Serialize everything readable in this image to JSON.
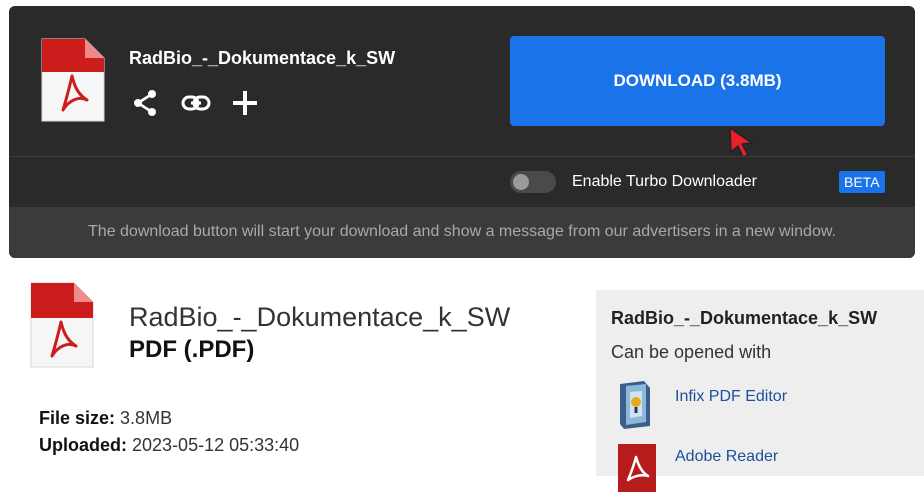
{
  "header": {
    "filename": "RadBio_-_Dokumentace_k_SW",
    "download_button_label": "DOWNLOAD (3.8MB)",
    "actions": [
      {
        "icon": "share-icon"
      },
      {
        "icon": "link-icon"
      },
      {
        "icon": "plus-icon"
      }
    ],
    "turbo": {
      "label": "Enable Turbo Downloader",
      "enabled": false,
      "badge": "BETA"
    },
    "notice": "The download button will start your download and show a message from our advertisers in a new window."
  },
  "file_info": {
    "name": "RadBio_-_Dokumentace_k_SW",
    "type": "PDF (.PDF)",
    "size_label": "File size:",
    "size_value": "3.8MB",
    "uploaded_label": "Uploaded:",
    "uploaded_value": "2023-05-12 05:33:40"
  },
  "sidebar": {
    "title": "RadBio_-_Dokumentace_k_SW",
    "subtitle": "Can be opened with",
    "apps": [
      {
        "name": "Infix PDF Editor",
        "icon": "infix-pdf-editor-icon"
      },
      {
        "name": "Adobe Reader",
        "icon": "adobe-reader-icon"
      }
    ]
  },
  "colors": {
    "panel_bg": "#2a2a2a",
    "accent": "#1a73e8",
    "pdf_red": "#cc1d1d",
    "link": "#1c4f9c"
  }
}
